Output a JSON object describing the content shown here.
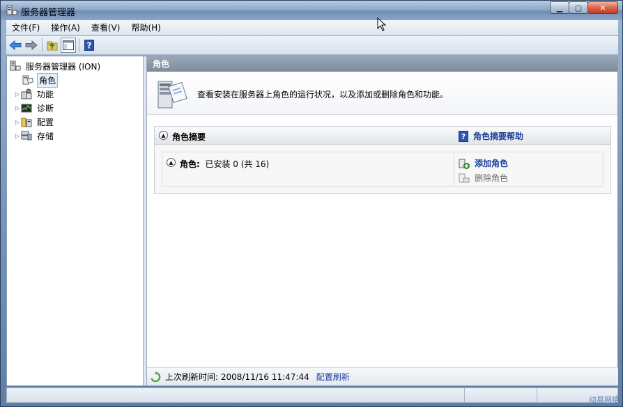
{
  "window": {
    "title": "服务器管理器"
  },
  "menu": [
    {
      "label": "文件(F)"
    },
    {
      "label": "操作(A)"
    },
    {
      "label": "查看(V)"
    },
    {
      "label": "帮助(H)"
    }
  ],
  "tree": {
    "root": "服务器管理器 (ION)",
    "items": [
      {
        "label": "角色",
        "selected": true
      },
      {
        "label": "功能"
      },
      {
        "label": "诊断"
      },
      {
        "label": "配置"
      },
      {
        "label": "存储"
      }
    ]
  },
  "content": {
    "header": "角色",
    "description": "查看安装在服务器上角色的运行状况，以及添加或删除角色和功能。",
    "summary": {
      "title": "角色摘要",
      "help": "角色摘要帮助",
      "roles_label": "角色:",
      "roles_value": "已安装 0 (共 16)",
      "actions": [
        {
          "label": "添加角色",
          "enabled": true
        },
        {
          "label": "删除角色",
          "enabled": false
        }
      ]
    },
    "footer": {
      "refresh_text": "上次刷新时间: 2008/11/16 11:47:44",
      "refresh_link": "配置刷新"
    }
  },
  "watermark": "动易网络",
  "colors": {
    "link": "#1a3f9e",
    "header": "#8a97a7",
    "selection": "#e5eefb"
  }
}
